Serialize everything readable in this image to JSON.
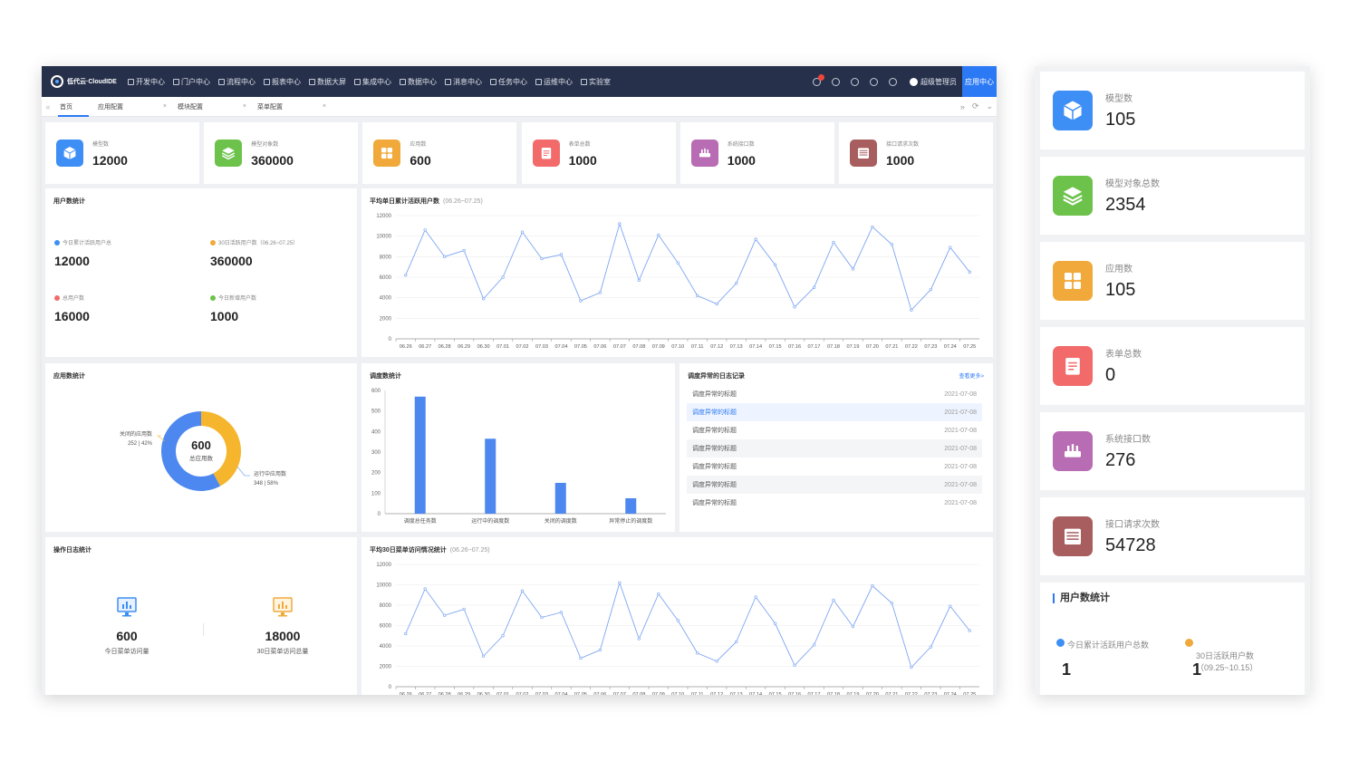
{
  "brand": {
    "name": "低代云·CloudIDE"
  },
  "nav": [
    "开发中心",
    "门户中心",
    "流程中心",
    "报表中心",
    "数据大屏",
    "集成中心",
    "数据中心",
    "消息中心",
    "任务中心",
    "运维中心",
    "实验室"
  ],
  "user": {
    "name": "超级管理员",
    "app_center": "应用中心"
  },
  "tabs": [
    {
      "label": "首页"
    },
    {
      "label": "应用配置"
    },
    {
      "label": "模块配置"
    },
    {
      "label": "菜单配置"
    }
  ],
  "stats": [
    {
      "label": "模型数",
      "value": "12000",
      "color": "#3d8ef5"
    },
    {
      "label": "模型对象数",
      "value": "360000",
      "color": "#6cc24a"
    },
    {
      "label": "应用数",
      "value": "600",
      "color": "#f0a93a"
    },
    {
      "label": "表单总数",
      "value": "1000",
      "color": "#f26a6a"
    },
    {
      "label": "系统接口数",
      "value": "1000",
      "color": "#b76cb4"
    },
    {
      "label": "接口请求次数",
      "value": "1000",
      "color": "#a85e5e"
    }
  ],
  "user_stats": {
    "title": "用户数统计",
    "items": [
      {
        "label": "今日累计活跃用户总",
        "value": "12000",
        "color": "#3d8ef5"
      },
      {
        "label": "30日活跃用户数（06.26~07.25）",
        "value": "360000",
        "color": "#f0a93a"
      },
      {
        "label": "总用户数",
        "value": "16000",
        "color": "#f26a6a"
      },
      {
        "label": "今日新增用户数",
        "value": "1000",
        "color": "#6cc24a"
      }
    ]
  },
  "app_stats": {
    "title": "应用数统计",
    "center_value": "600",
    "center_label": "总应用数",
    "closed_label": "关闭的应用数",
    "closed_detail": "252 | 42%",
    "running_label": "运行中应用数",
    "running_detail": "348 | 58%"
  },
  "schedule": {
    "title": "调度数统计"
  },
  "logs": {
    "title": "调度异常的日志记录",
    "more": "查看更多>",
    "rows": [
      {
        "title": "调度异常的标题",
        "date": "2021-07-08"
      },
      {
        "title": "调度异常的标题",
        "date": "2021-07-08"
      },
      {
        "title": "调度异常的标题",
        "date": "2021-07-08"
      },
      {
        "title": "调度异常的标题",
        "date": "2021-07-08"
      },
      {
        "title": "调度异常的标题",
        "date": "2021-07-08"
      },
      {
        "title": "调度异常的标题",
        "date": "2021-07-08"
      },
      {
        "title": "调度异常的标题",
        "date": "2021-07-08"
      }
    ]
  },
  "op_stats": {
    "title": "操作日志统计",
    "today_value": "600",
    "today_label": "今日菜单访问量",
    "month_value": "18000",
    "month_label": "30日菜单访问总量"
  },
  "line1": {
    "title": "平均单日累计活跃用户数",
    "range": "(06.26~07.25)"
  },
  "line2": {
    "title": "平均30日菜单访问情况统计",
    "range": "(06.26~07.25)"
  },
  "chart_data": [
    {
      "type": "line",
      "title": "平均单日累计活跃用户数",
      "subtitle": "(06.26~07.25)",
      "categories": [
        "06.26",
        "06.27",
        "06.28",
        "06.29",
        "06.30",
        "07.01",
        "07.02",
        "07.03",
        "07.04",
        "07.05",
        "07.06",
        "07.07",
        "07.08",
        "07.09",
        "07.10",
        "07.11",
        "07.12",
        "07.13",
        "07.14",
        "07.15",
        "07.16",
        "07.17",
        "07.18",
        "07.19",
        "07.20",
        "07.21",
        "07.22",
        "07.23",
        "07.24",
        "07.25"
      ],
      "values": [
        6200,
        10600,
        8000,
        8600,
        3900,
        6000,
        10400,
        7800,
        8200,
        3700,
        4500,
        11200,
        5700,
        10100,
        7400,
        4200,
        3400,
        5400,
        9700,
        7200,
        3100,
        5000,
        9400,
        6800,
        10900,
        9200,
        2800,
        4800,
        8900,
        6500
      ],
      "ylim": [
        0,
        12000
      ],
      "yticks": [
        0,
        2000,
        4000,
        6000,
        8000,
        10000,
        12000
      ],
      "grid": true
    },
    {
      "type": "bar",
      "title": "调度数统计",
      "categories": [
        "调度总任务数",
        "运行中的调度数",
        "关闭的调度数",
        "异常停止的调度数"
      ],
      "values": [
        570,
        365,
        150,
        75
      ],
      "ylim": [
        0,
        600
      ],
      "yticks": [
        0,
        100,
        200,
        300,
        400,
        500,
        600
      ],
      "color": "#4d87f0"
    },
    {
      "type": "pie",
      "title": "应用数统计",
      "slices": [
        {
          "name": "关闭的应用数",
          "value": 252,
          "percent": 42,
          "color": "#f5b62e"
        },
        {
          "name": "运行中应用数",
          "value": 348,
          "percent": 58,
          "color": "#4d87f0"
        }
      ]
    },
    {
      "type": "line",
      "title": "平均30日菜单访问情况统计",
      "subtitle": "(06.26~07.25)",
      "categories": [
        "06.26",
        "06.27",
        "06.28",
        "06.29",
        "06.30",
        "07.01",
        "07.02",
        "07.03",
        "07.04",
        "07.05",
        "07.06",
        "07.07",
        "07.08",
        "07.09",
        "07.10",
        "07.11",
        "07.12",
        "07.13",
        "07.14",
        "07.15",
        "07.16",
        "07.17",
        "07.18",
        "07.19",
        "07.20",
        "07.21",
        "07.22",
        "07.23",
        "07.24",
        "07.25"
      ],
      "values": [
        5200,
        9600,
        7000,
        7600,
        3000,
        5000,
        9400,
        6800,
        7300,
        2800,
        3600,
        10200,
        4700,
        9100,
        6500,
        3300,
        2500,
        4400,
        8800,
        6200,
        2100,
        4100,
        8500,
        5900,
        9900,
        8200,
        1900,
        3900,
        7900,
        5500
      ],
      "ylim": [
        0,
        12000
      ],
      "yticks": [
        0,
        2000,
        4000,
        6000,
        8000,
        10000,
        12000
      ],
      "grid": true
    }
  ],
  "side": {
    "stats": [
      {
        "label": "模型数",
        "value": "105",
        "color": "#3d8ef5"
      },
      {
        "label": "模型对象总数",
        "value": "2354",
        "color": "#6cc24a"
      },
      {
        "label": "应用数",
        "value": "105",
        "color": "#f0a93a"
      },
      {
        "label": "表单总数",
        "value": "0",
        "color": "#f26a6a"
      },
      {
        "label": "系统接口数",
        "value": "276",
        "color": "#b76cb4"
      },
      {
        "label": "接口请求次数",
        "value": "54728",
        "color": "#a85e5e"
      }
    ],
    "user_title": "用户数统计",
    "user_items": [
      {
        "label": "今日累计活跃用户总数",
        "value": "1",
        "color": "#3d8ef5"
      },
      {
        "label": "30日活跃用户数（09.25~10.15）",
        "value": "1",
        "color": "#f0a93a"
      }
    ]
  }
}
